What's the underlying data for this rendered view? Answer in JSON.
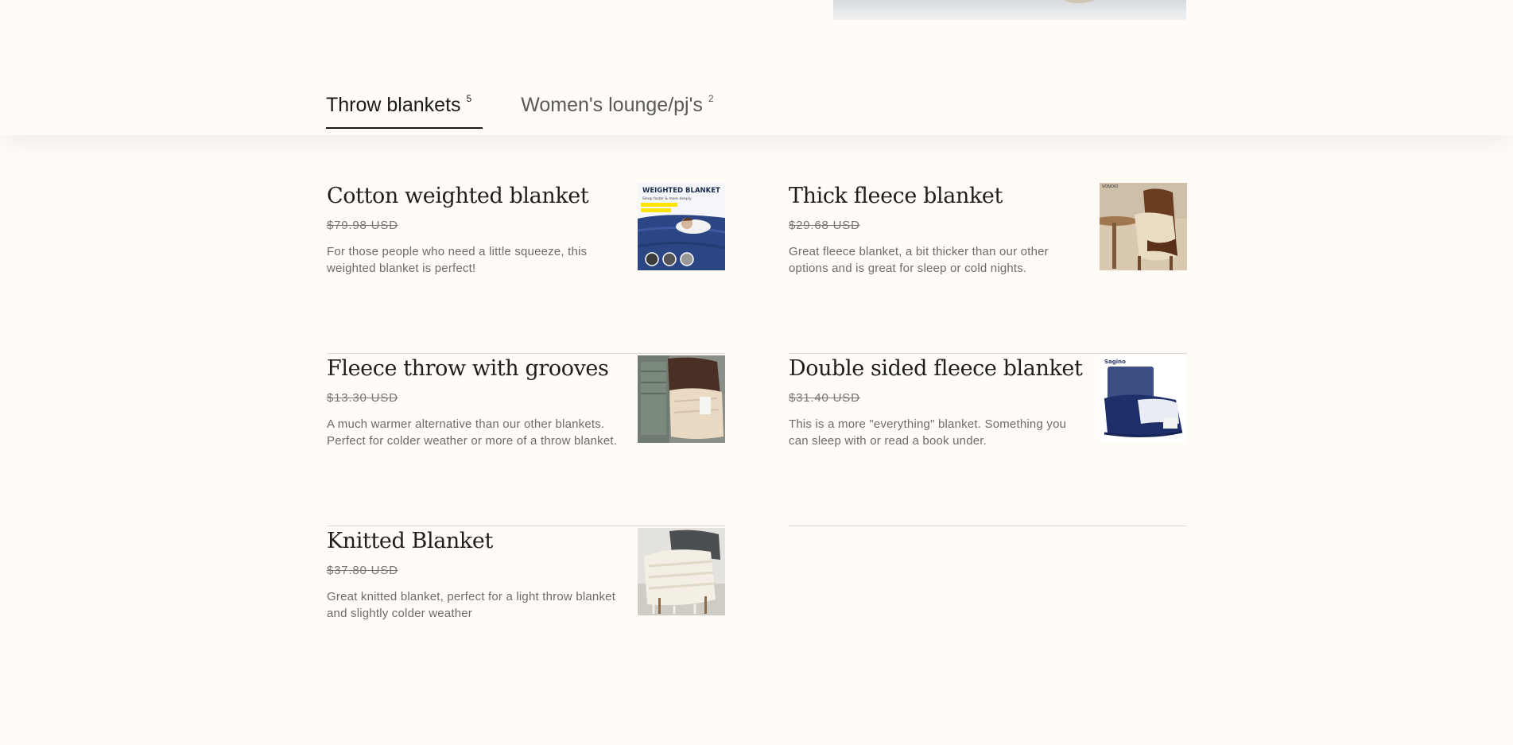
{
  "tabs": [
    {
      "label": "Throw blankets",
      "count": "5",
      "active": true
    },
    {
      "label": "Women's lounge/pj's",
      "count": "2",
      "active": false
    }
  ],
  "products": [
    {
      "name": "Cotton weighted blanket",
      "price": "$79.98 USD",
      "description": "For those people who need a little squeeze, this weighted blanket is perfect!",
      "image_icon": "weighted-blanket-photo",
      "image_text": {
        "title": "WEIGHTED BLANKET",
        "subtitle": "Sleep faster & more deeply"
      }
    },
    {
      "name": "Thick fleece blanket",
      "price": "$29.68 USD",
      "description": "Great fleece blanket, a bit thicker than our other options and is great for sleep or cold nights.",
      "image_icon": "fleece-blanket-chair-photo",
      "image_text": {
        "brand": "VONOIO"
      }
    },
    {
      "name": "Fleece throw with grooves",
      "price": "$13.30 USD",
      "description": "A much warmer alternative than our other blankets. Perfect for colder weather or more of a throw blanket.",
      "image_icon": "folded-throws-photo"
    },
    {
      "name": "Double sided fleece blanket",
      "price": "$31.40 USD",
      "description": "This is a more \"everything\" blanket. Something you can sleep with or read a book under.",
      "image_icon": "navy-fleece-package-photo",
      "image_text": {
        "brand": "Sagino"
      }
    },
    {
      "name": "Knitted Blanket",
      "price": "$37.80 USD",
      "description": "Great knitted blanket, perfect for a light throw blanket and slightly colder weather",
      "image_icon": "knitted-blanket-photo"
    }
  ]
}
